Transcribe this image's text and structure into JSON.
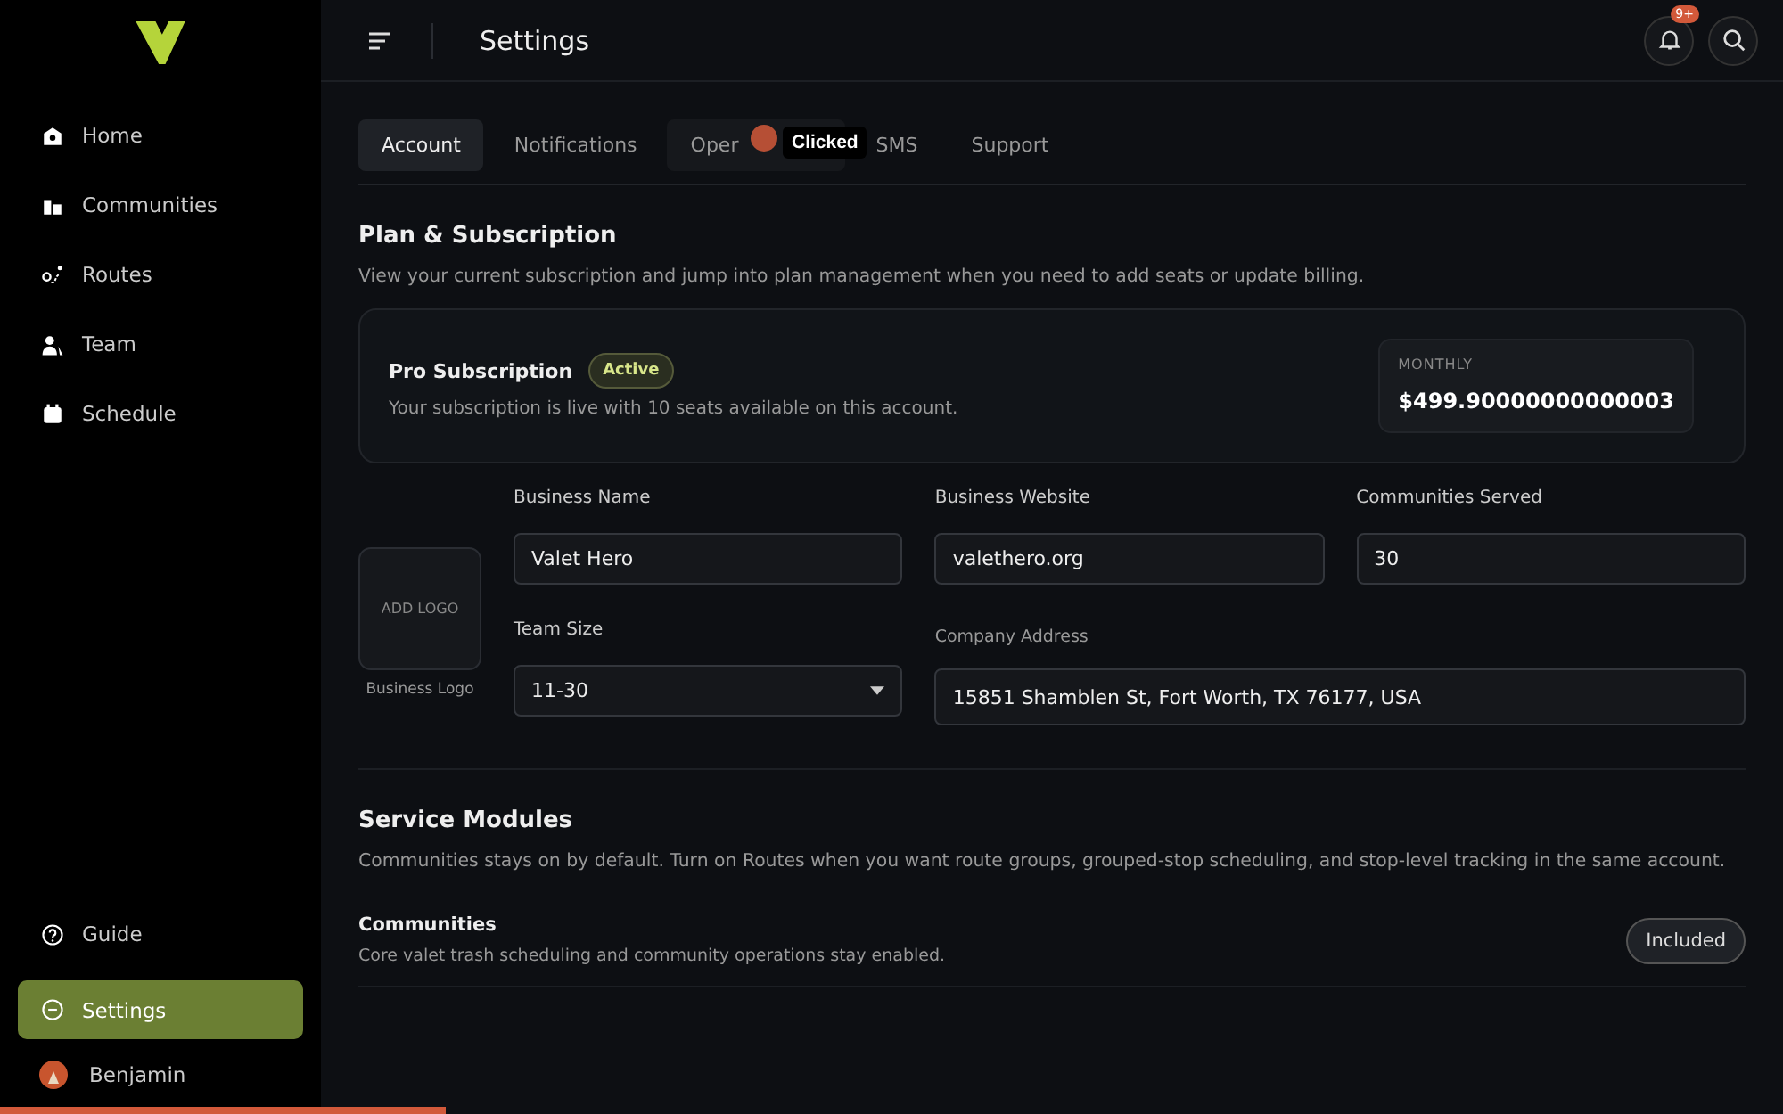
{
  "sidebar": {
    "nav": [
      {
        "label": "Home",
        "selected": false
      },
      {
        "label": "Communities",
        "selected": false
      },
      {
        "label": "Routes",
        "selected": false
      },
      {
        "label": "Team",
        "selected": false
      },
      {
        "label": "Schedule",
        "selected": false
      }
    ],
    "bottom_nav": [
      {
        "label": "Guide",
        "selected": false
      },
      {
        "label": "Settings",
        "selected": true
      }
    ],
    "user": {
      "name": "Benjamin"
    }
  },
  "header": {
    "title": "Settings",
    "notification_badge": "9+"
  },
  "tabs": [
    {
      "label": "Account",
      "selected": true
    },
    {
      "label": "Notifications",
      "selected": false
    },
    {
      "label": "Oper",
      "selected": false,
      "hovered": true
    },
    {
      "label": "SMS",
      "selected": false
    },
    {
      "label": "Support",
      "selected": false
    }
  ],
  "click_tooltip": "Clicked",
  "plan": {
    "heading": "Plan & Subscription",
    "description": "View your current subscription and jump into plan management when you need to add seats or update billing.",
    "name": "Pro Subscription",
    "status": "Active",
    "detail": "Your subscription is live with 10 seats available on this account.",
    "price_label": "MONTHLY",
    "price": "$499.90000000000003"
  },
  "business": {
    "logo_button": "ADD LOGO",
    "logo_caption": "Business Logo",
    "fields": [
      {
        "label": "Business Name",
        "value": "Valet Hero",
        "kind": "text"
      },
      {
        "label": "Business Website",
        "value": "valethero.org",
        "kind": "text"
      },
      {
        "label": "Communities Served",
        "value": "30",
        "kind": "text"
      },
      {
        "label": "Team Size",
        "value": "11-30",
        "kind": "select"
      },
      {
        "label": "Company Address",
        "value": "15851 Shamblen St, Fort Worth, TX 76177, USA",
        "kind": "wide"
      }
    ]
  },
  "modules": {
    "heading": "Service Modules",
    "description": "Communities stays on by default. Turn on Routes when you want route groups, grouped-stop scheduling, and stop-level tracking in the same account.",
    "items": [
      {
        "name": "Communities",
        "description": "Core valet trash scheduling and community operations stay enabled.",
        "status": "Included"
      }
    ]
  },
  "page_progress": {
    "level": 0.25
  }
}
